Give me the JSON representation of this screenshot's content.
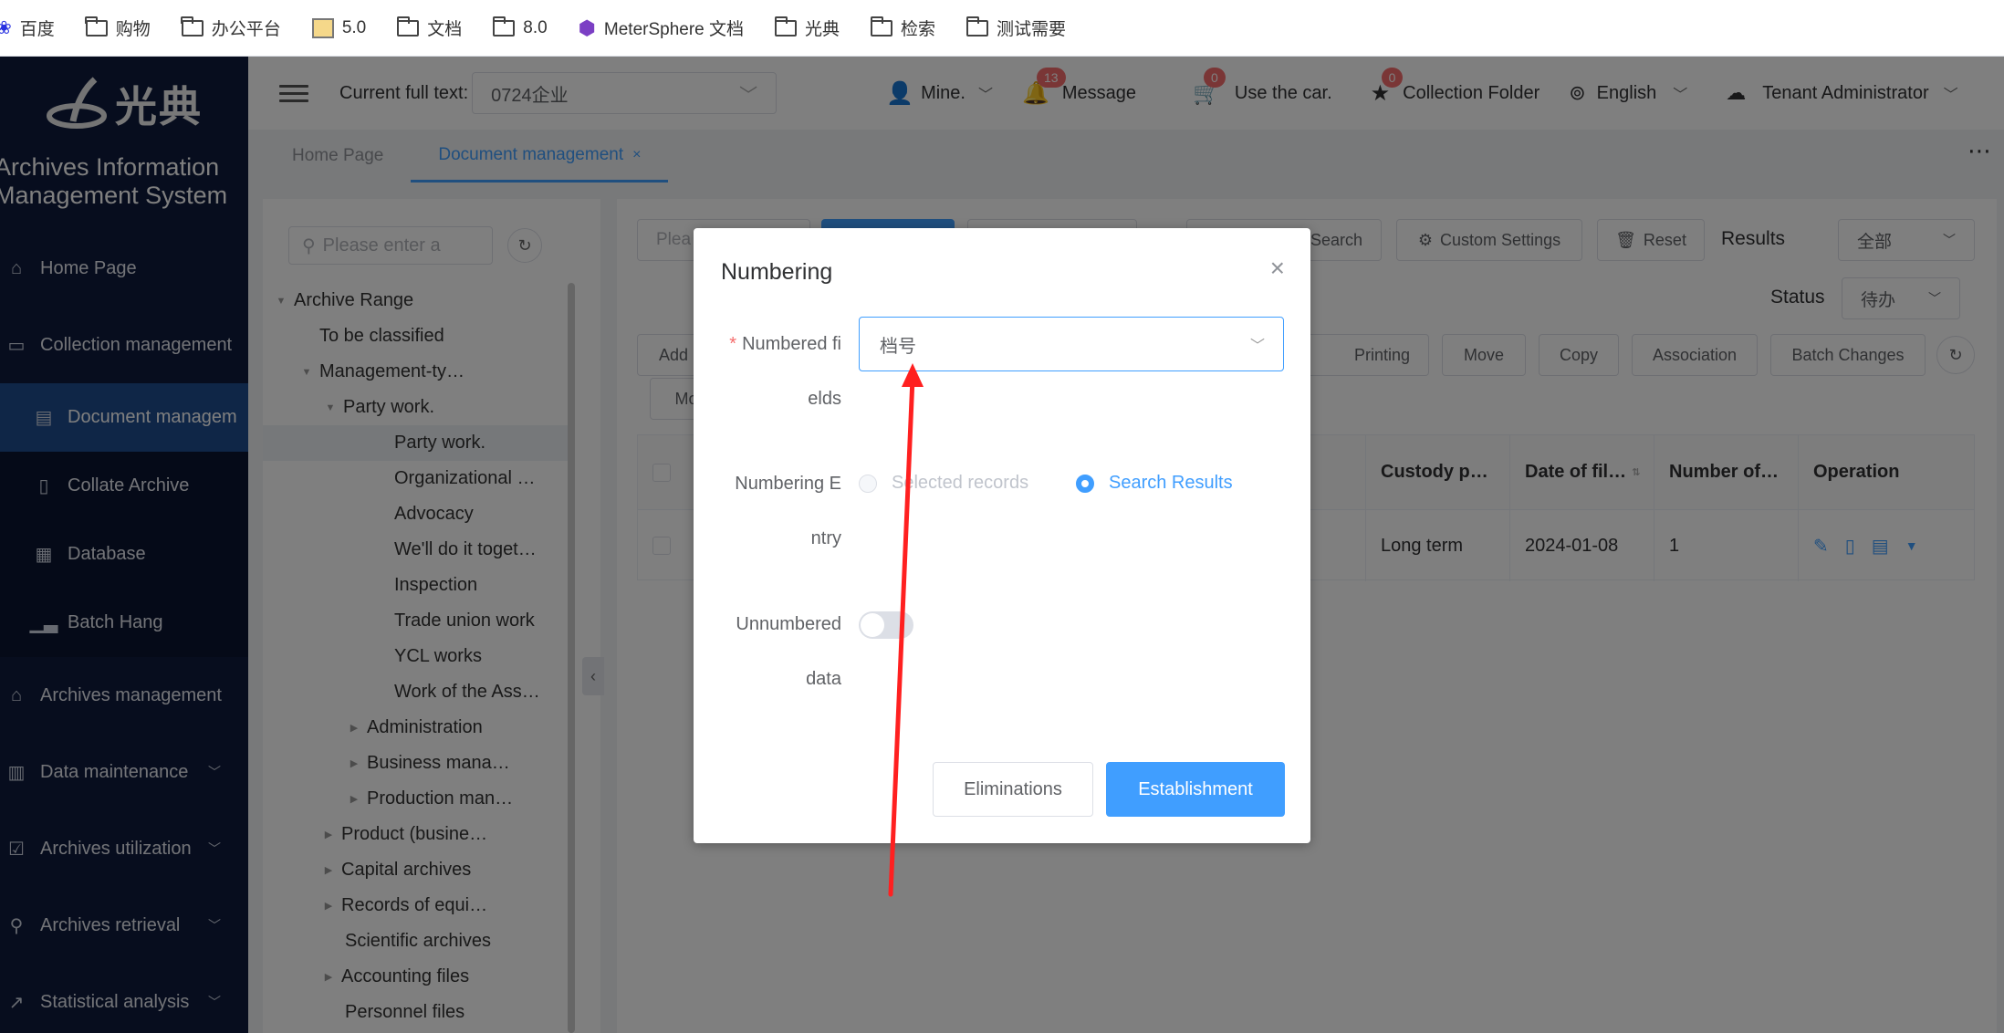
{
  "bookmarks": [
    {
      "label": "百度",
      "icon": "baidu-icon"
    },
    {
      "label": "购物",
      "icon": "folder-icon"
    },
    {
      "label": "办公平台",
      "icon": "folder-icon"
    },
    {
      "label": "5.0",
      "icon": "image-icon"
    },
    {
      "label": "文档",
      "icon": "folder-icon"
    },
    {
      "label": "8.0",
      "icon": "folder-icon"
    },
    {
      "label": "MeterSphere 文档",
      "icon": "metersphere-icon"
    },
    {
      "label": "光典",
      "icon": "folder-icon"
    },
    {
      "label": "检索",
      "icon": "folder-icon"
    },
    {
      "label": "测试需要",
      "icon": "folder-icon"
    }
  ],
  "sidebar": {
    "logo_text": "光典",
    "title_line1": "Archives Information",
    "title_line2": "Management System",
    "items": [
      {
        "label": "Home Page",
        "icon": "home-icon"
      },
      {
        "label": "Collection management",
        "icon": "box-icon"
      },
      {
        "label": "Document managem",
        "icon": "document-icon"
      },
      {
        "label": "Collate Archive",
        "icon": "file-icon"
      },
      {
        "label": "Database",
        "icon": "calendar-icon"
      },
      {
        "label": "Batch Hang",
        "icon": "chart-icon"
      },
      {
        "label": "Archives management",
        "icon": "bank-icon"
      },
      {
        "label": "Data maintenance",
        "icon": "building-icon"
      },
      {
        "label": "Archives utilization",
        "icon": "clipboard-icon"
      },
      {
        "label": "Archives retrieval",
        "icon": "search-icon"
      },
      {
        "label": "Statistical analysis",
        "icon": "line-chart-icon"
      }
    ]
  },
  "header": {
    "fulltext_label": "Current full text:",
    "fulltext_value": "0724企业",
    "user": "Mine.",
    "message_label": "Message",
    "message_count": "13",
    "cart_label": "Use the car.",
    "cart_count": "0",
    "collection_label": "Collection Folder",
    "collection_count": "0",
    "language": "English",
    "tenant": "Tenant Administrator"
  },
  "tabs": [
    {
      "label": "Home Page"
    },
    {
      "label": "Document management"
    }
  ],
  "tree": {
    "search_placeholder": "Please enter a",
    "nodes": [
      {
        "label": "Archive Range"
      },
      {
        "label": "To be classified"
      },
      {
        "label": "Management-ty…"
      },
      {
        "label": "Party work."
      },
      {
        "label": "Party work."
      },
      {
        "label": "Organizational …"
      },
      {
        "label": "Advocacy"
      },
      {
        "label": "We'll do it toget…"
      },
      {
        "label": "Inspection"
      },
      {
        "label": "Trade union work"
      },
      {
        "label": "YCL works"
      },
      {
        "label": "Work of the Ass…"
      },
      {
        "label": "Administration"
      },
      {
        "label": "Business mana…"
      },
      {
        "label": "Production man…"
      },
      {
        "label": "Product (busine…"
      },
      {
        "label": "Capital archives"
      },
      {
        "label": "Records of equi…"
      },
      {
        "label": "Scientific archives"
      },
      {
        "label": "Accounting files"
      },
      {
        "label": "Personnel files"
      }
    ]
  },
  "main": {
    "search_placeholder": "Plea",
    "search_label": "Search",
    "custom_settings": "Custom Settings",
    "reset": "Reset",
    "results_label": "Results",
    "results_value": "全部",
    "status_label": "Status",
    "status_value": "待办",
    "actions": [
      "Add",
      "Printing",
      "Move",
      "Copy",
      "Association",
      "Batch Changes"
    ],
    "more_action": "Mo",
    "columns": [
      "Custody p…",
      "Date of fil…",
      "Number of…",
      "Operation"
    ],
    "row": {
      "custody": "Long term",
      "date": "2024-01-08",
      "number": "1"
    }
  },
  "dialog": {
    "title": "Numbering",
    "field_label_1": "Numbered fi",
    "field_label_2": "elds",
    "field_value": "档号",
    "entry_label_1": "Numbering E",
    "entry_label_2": "ntry",
    "option_selected": "Selected records",
    "option_search": "Search Results",
    "unnumbered_label_1": "Unnumbered",
    "unnumbered_label_2": "data",
    "cancel": "Eliminations",
    "confirm": "Establishment"
  },
  "colors": {
    "primary": "#409eff",
    "sidebar": "#0f1b3d",
    "badge": "#f56c6c",
    "arrow": "#ff2020"
  }
}
